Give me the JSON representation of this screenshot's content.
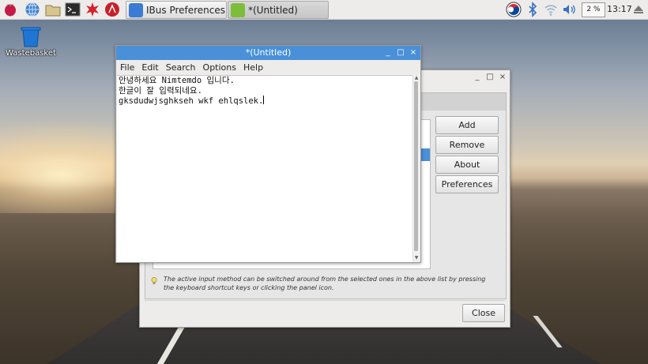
{
  "taskbar": {
    "tasks": [
      {
        "label": "IBus Preferences"
      },
      {
        "label": "*(Untitled)"
      }
    ],
    "cpu": "2 %",
    "clock": "13:17"
  },
  "desktop": {
    "icons": [
      {
        "label": "Wastebasket"
      }
    ]
  },
  "ibus_window": {
    "buttons": {
      "add": "Add",
      "remove": "Remove",
      "about": "About",
      "preferences": "Preferences"
    },
    "info": "The active input method can be switched around from the selected ones in the above list by pressing the keyboard shortcut keys or clicking the panel icon.",
    "close": "Close"
  },
  "editor_window": {
    "title": "*(Untitled)",
    "menu": [
      "File",
      "Edit",
      "Search",
      "Options",
      "Help"
    ],
    "lines": [
      "안녕하세요 Nimtemdo 입니다.",
      "한글이 잘 입력되네요.",
      "gksdudwjsghkseh wkf ehlqslek."
    ]
  },
  "colors": {
    "accent": "#4a90d9",
    "panel": "#edeceb"
  }
}
